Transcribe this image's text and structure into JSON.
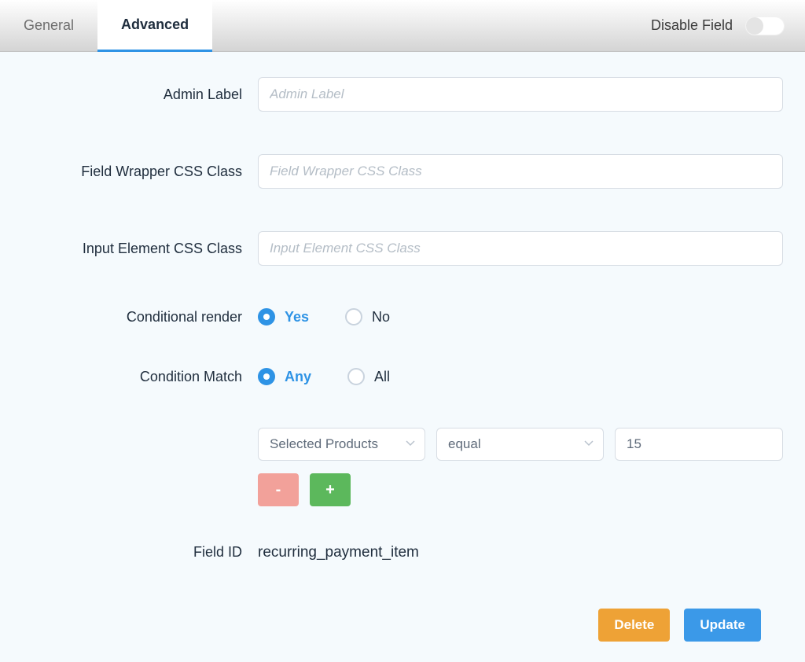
{
  "tabs": {
    "general": "General",
    "advanced": "Advanced",
    "active": "advanced"
  },
  "disable": {
    "label": "Disable Field",
    "on": false
  },
  "fields": {
    "admin_label": {
      "label": "Admin Label",
      "placeholder": "Admin Label",
      "value": ""
    },
    "wrapper_class": {
      "label": "Field Wrapper CSS Class",
      "placeholder": "Field Wrapper CSS Class",
      "value": ""
    },
    "input_class": {
      "label": "Input Element CSS Class",
      "placeholder": "Input Element CSS Class",
      "value": ""
    },
    "conditional_render": {
      "label": "Conditional render",
      "options": {
        "yes": "Yes",
        "no": "No"
      },
      "value": "yes"
    },
    "condition_match": {
      "label": "Condition Match",
      "options": {
        "any": "Any",
        "all": "All"
      },
      "value": "any"
    },
    "condition_rule": {
      "field": "Selected Products",
      "operator": "equal",
      "value": "15"
    },
    "field_id": {
      "label": "Field ID",
      "value": "recurring_payment_item"
    }
  },
  "buttons": {
    "remove": "-",
    "add": "+",
    "delete": "Delete",
    "update": "Update"
  }
}
